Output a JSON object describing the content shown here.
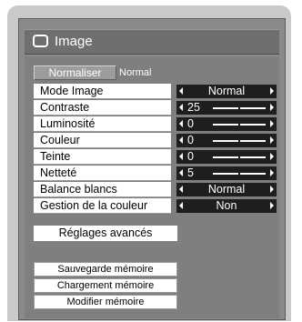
{
  "window": {
    "title": "Image",
    "icon": "screen-icon"
  },
  "normalize": {
    "button_label": "Normaliser",
    "current": "Normal"
  },
  "settings": [
    {
      "label": "Mode Image",
      "kind": "select",
      "value": "Normal"
    },
    {
      "label": "Contraste",
      "kind": "slider",
      "value": "25",
      "level": 0.5
    },
    {
      "label": "Luminosité",
      "kind": "slider",
      "value": "0",
      "level": 0.5
    },
    {
      "label": "Couleur",
      "kind": "slider",
      "value": "0",
      "level": 0.5
    },
    {
      "label": "Teinte",
      "kind": "slider",
      "value": "0",
      "level": 0.5
    },
    {
      "label": "Netteté",
      "kind": "slider",
      "value": "5",
      "level": 0.5
    },
    {
      "label": "Balance blancs",
      "kind": "select",
      "value": "Normal"
    },
    {
      "label": "Gestion de la couleur",
      "kind": "select",
      "value": "Non"
    }
  ],
  "advanced": {
    "label": "Réglages avancés"
  },
  "memory": {
    "save": "Sauvegarde mémoire",
    "load": "Chargement mémoire",
    "modify": "Modifier mémoire"
  }
}
